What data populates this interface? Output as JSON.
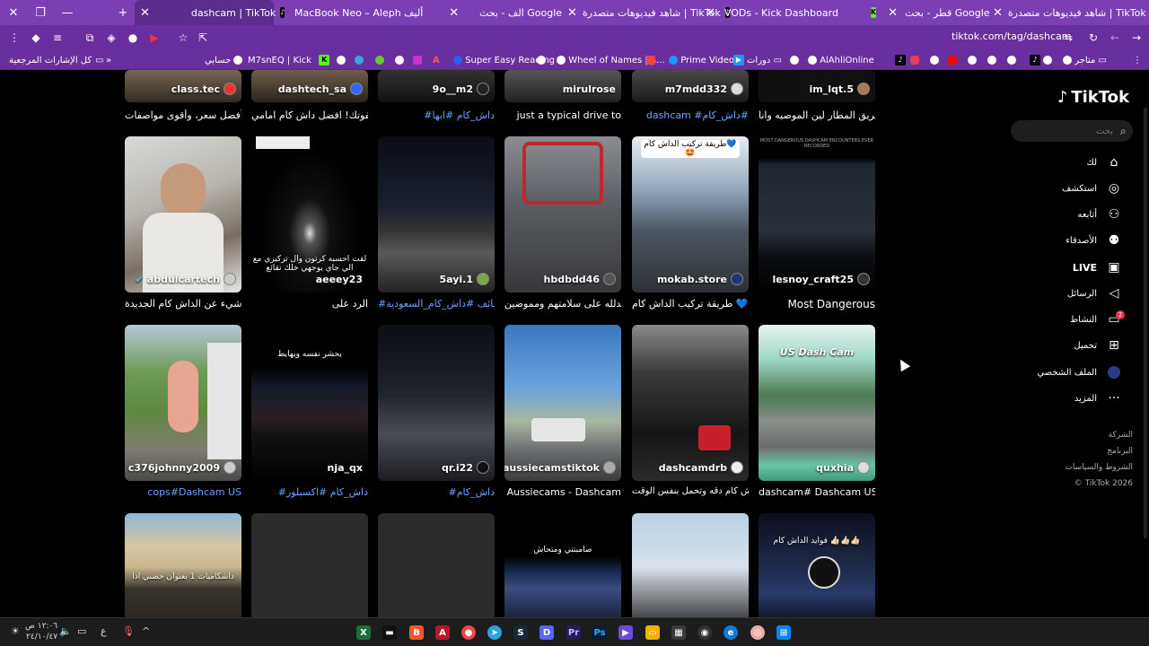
{
  "tabs": [
    {
      "title": "dashcam | TikTok",
      "icon": "tiktok",
      "active": true
    },
    {
      "title": "MacBook Neo – Aleph أليف",
      "icon": "aleph"
    },
    {
      "title": "الف - بحث Google",
      "icon": "google"
    },
    {
      "title": "شاهد فيديوهات متصدرة | TikTok",
      "icon": "tiktok"
    },
    {
      "title": "VODs - Kick Dashboard",
      "icon": "kick"
    },
    {
      "title": "قطر - بحث Google",
      "icon": "google"
    },
    {
      "title": "شاهد فيديوهات متصدرة | TikTok",
      "icon": "tiktok"
    }
  ],
  "address": {
    "url": "tiktok.com/tag/dashcam"
  },
  "bookmarks": {
    "all_bookmarks": "كل الإشارات المرجعية",
    "items": [
      "حسابي",
      "M7snEQ | Kick",
      "Super Easy Reading",
      "Wheel of Names | م...",
      "Prime Video",
      "دورات",
      "AlAhliOnline",
      "متاجر"
    ]
  },
  "top_row": [
    {
      "user": "class.tec",
      "caption": "أفضل سعر، وأقوى مواصفات."
    },
    {
      "user": "dashtech_sa",
      "caption": "لا تفوتك! افضل داش كام امامي"
    },
    {
      "user": "9o__m2",
      "caption": "#داش_كام #ابها"
    },
    {
      "user": "mirulrose",
      "caption": "just a typical drive to"
    },
    {
      "user": "m7mdd332",
      "caption": "dashcam #داش_كام#"
    },
    {
      "user": "im_lqt.5",
      "caption": "من طريق المطار لين الموصيه وانا"
    }
  ],
  "row2": [
    {
      "user": "abdulcartech",
      "caption": "كل شيء عن الداش كام الجديدة",
      "overlay": ""
    },
    {
      "user": "aeeey23",
      "caption": "الرد على",
      "overlay": "لقت احسبه كرتون وال تركيزي مع الي جاي يوجهي خلك تقائع"
    },
    {
      "user": "5ayi.1",
      "caption": "#الطائف #داش_كام_السعودية",
      "overlay": ""
    },
    {
      "user": "hbdbdd46",
      "caption": "الحمدلله على سلامتهم ومموضين",
      "overlay": ""
    },
    {
      "user": "mokab.store",
      "caption": "طريقة تركيب الداش كام 💙 🤩",
      "overlay": "طريقة تركيب الداش كام💙🤩"
    },
    {
      "user": "lesnoy_craft25",
      "caption": "Most Dangerous",
      "overlay": "MOST DANGEROUS DASHCAM ENCOUNTERS EVER RECORDED"
    }
  ],
  "row3": [
    {
      "user": "c376johnny2009",
      "caption": "cops#Dashcam US",
      "overlay": ""
    },
    {
      "user": "nja_qx",
      "caption": "#داش_كام #اكسبلور",
      "overlay": "يحشر نفسه ويهايط"
    },
    {
      "user": "qr.i22",
      "caption": "#داش_كام",
      "overlay": ""
    },
    {
      "user": "aussiecamstiktok",
      "caption": "Aussiecams - Dashcam",
      "overlay": ""
    },
    {
      "user": "dashcamdrb",
      "caption": "تبي داش كام دقه وتحمل بنفس الوقت",
      "overlay": ""
    },
    {
      "user": "quxhia",
      "caption": "dashcam# Dashcam US",
      "overlay": "US Dash Cam"
    }
  ],
  "row4": [
    {
      "overlay": "داشكاميات 1 بعنوان حضني اذا"
    },
    {
      "overlay": ""
    },
    {
      "overlay": ""
    },
    {
      "overlay": "صامبتني ومتحاش"
    },
    {
      "overlay": ""
    },
    {
      "overlay": "فوايد الداش كام 👍🏻👍🏻👍🏻"
    }
  ],
  "sidebar": {
    "logo": "TikTok",
    "search_placeholder": "بحث",
    "nav": [
      "لك",
      "استكشف",
      "أتابعه",
      "الأصدقاء",
      "LIVE",
      "الرسائل",
      "النشاط",
      "تحميل",
      "الملف الشخصي",
      "المزيد"
    ],
    "activity_badge": "2",
    "footer": [
      "الشركة",
      "البرنامج",
      "الشروط والسياسات",
      "© TikTok 2026"
    ]
  },
  "taskbar": {
    "clock_time": "١٢:٠٦ ص",
    "clock_date": "٢٤/١٠/٤٧",
    "lang": "ع"
  },
  "colors": {
    "tabbar": "#7b3fb3",
    "toolbar": "#6a2f9f",
    "hashtag": "#6ea0ff",
    "badge": "#fe2c55"
  }
}
